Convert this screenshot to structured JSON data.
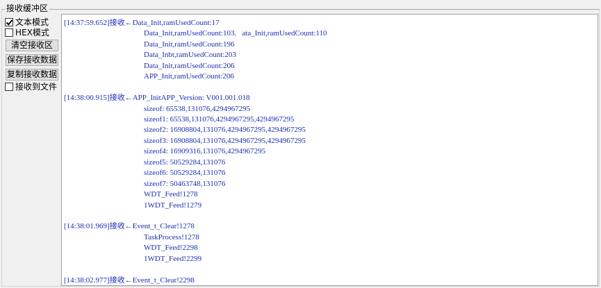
{
  "group_title": "接收缓冲区",
  "options": {
    "text_mode": {
      "label": "文本模式",
      "checked": true
    },
    "hex_mode": {
      "label": "HEX模式",
      "checked": false
    },
    "receive_to_file": {
      "label": "接收到文件",
      "checked": false
    }
  },
  "buttons": {
    "clear": "清空接收区",
    "save": "保存接收数据",
    "copy": "复制接收数据"
  },
  "log_lines": [
    "[14:37:59.652]接收←Data_Init,ramUsedCount:17",
    "Data_Init,ramUsedCount:103.   ata_Init,ramUsedCount:110",
    "Data_Init,ramUsedCount:196",
    "Data_Inbt,ramUsedCount:203",
    "Data_Init,ramUsedCount:206",
    "APP_Init,ramUsedCount:206",
    "[14:38:00.915]接收←APP_InitAPP_Version: V001.001.018",
    "sizeof: 65538,131076,4294967295",
    "sizeof1: 65538,131076,4294967295,4294967295",
    "sizeof2: 16908804,131076,4294967295,4294967295",
    "sizeof3: 16908804,131076,4294967295,4294967295",
    "sizeof4: 16909316,131076,4294967295",
    "sizeof5: 50529284,131076",
    "sizeof6: 50529284,131076",
    "sizeof7: 50463748,131076",
    "WDT_Feed!1278",
    "1WDT_Feed!1279",
    "[14:38:01.969]接收←Event_t_Clear!1278",
    "TaskProcess!1278",
    "WDT_Feed!2298",
    "1WDT_Feed!2299",
    "[14:38:02.977]接收←Event_t_Clear!2298"
  ]
}
